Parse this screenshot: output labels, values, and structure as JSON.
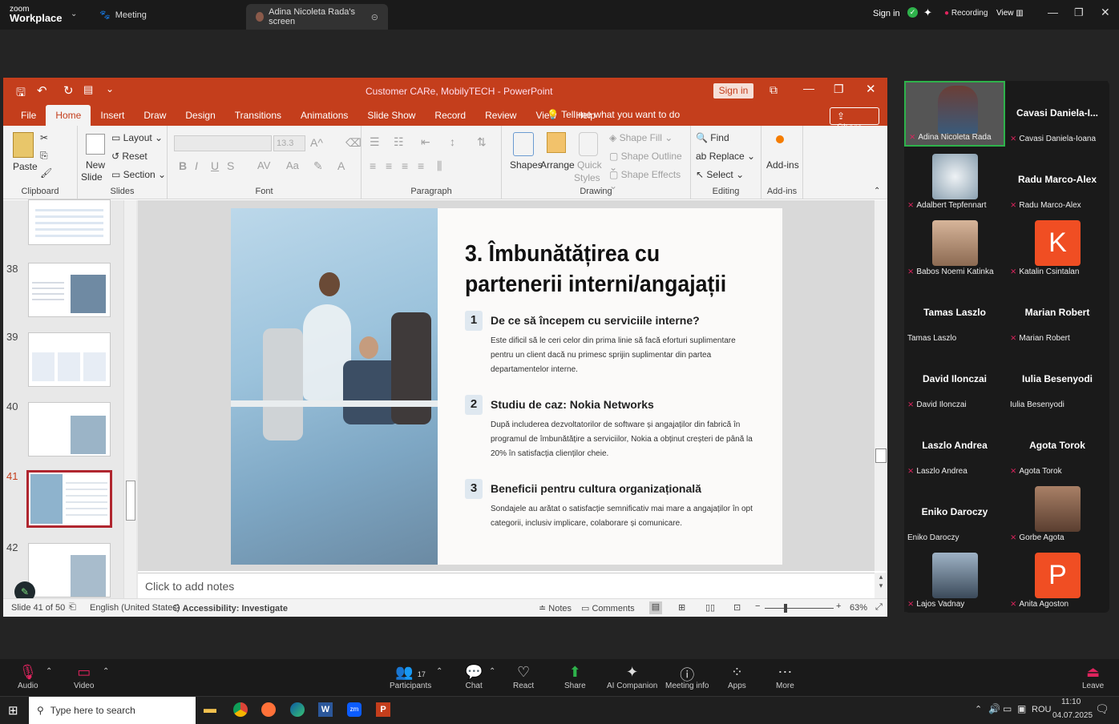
{
  "zoom": {
    "logo_top": "zoom",
    "logo_bottom": "Workplace",
    "meeting_tab": "Meeting",
    "share_tab": "Adina Nicoleta Rada's screen",
    "sign_in": "Sign in",
    "recording": "Recording",
    "view": "View"
  },
  "powerpoint": {
    "title": "Customer CARe, MobilyTECH  -  PowerPoint",
    "sign_in": "Sign in",
    "share": "Share",
    "tabs": [
      "File",
      "Home",
      "Insert",
      "Draw",
      "Design",
      "Transitions",
      "Animations",
      "Slide Show",
      "Record",
      "Review",
      "View",
      "Help"
    ],
    "tell_me": "Tell me what you want to do",
    "ribbon": {
      "paste": "Paste",
      "clipboard": "Clipboard",
      "new_slide_1": "New",
      "new_slide_2": "Slide",
      "layout": "Layout",
      "reset": "Reset",
      "section": "Section",
      "slides": "Slides",
      "font_size": "13.3",
      "font": "Font",
      "paragraph": "Paragraph",
      "shapes": "Shapes",
      "arrange": "Arrange",
      "quick_1": "Quick",
      "quick_2": "Styles",
      "shape_fill": "Shape Fill",
      "shape_outline": "Shape Outline",
      "shape_effects": "Shape Effects",
      "drawing": "Drawing",
      "find": "Find",
      "replace": "Replace",
      "select": "Select",
      "editing": "Editing",
      "addins": "Add-ins",
      "addins_group": "Add-ins"
    },
    "thumb_numbers": [
      "38",
      "39",
      "40",
      "41",
      "42"
    ],
    "slide": {
      "title": "3. Îmbunătățirea cu partenerii interni/angajații",
      "items": [
        {
          "num": "1",
          "heading": "De ce să începem cu serviciile interne?",
          "text": "Este dificil să le ceri celor din prima linie să facă eforturi suplimentare pentru un client dacă nu primesc sprijin suplimentar din partea departamentelor interne."
        },
        {
          "num": "2",
          "heading": "Studiu de caz: Nokia Networks",
          "text": "După includerea dezvoltatorilor de software și angajaților din fabrică în programul de îmbunătățire a serviciilor, Nokia a obținut creșteri de până la 20% în satisfacția clienților cheie."
        },
        {
          "num": "3",
          "heading": "Beneficii pentru cultura organizațională",
          "text": "Sondajele au arătat o satisfacție semnificativ mai mare a angajaților în opt categorii, inclusiv implicare, colaborare și comunicare."
        }
      ]
    },
    "notes_placeholder": "Click to add notes",
    "status": {
      "slide_of": "Slide 41 of 50",
      "language": "English (United States)",
      "accessibility": "Accessibility: Investigate",
      "notes": "Notes",
      "comments": "Comments",
      "zoom": "63%"
    }
  },
  "participants": [
    {
      "name": "Adina Nicoleta Rada",
      "big": ""
    },
    {
      "name": "Cavasi Daniela-Ioana",
      "big": "Cavasi  Daniela-I..."
    },
    {
      "name": "Adalbert Tepfennart",
      "big": ""
    },
    {
      "name": "Radu Marco-Alex",
      "big": "Radu Marco-Alex"
    },
    {
      "name": "Babos Noemi Katinka",
      "big": ""
    },
    {
      "name": "Katalin Csintalan",
      "big": ""
    },
    {
      "name": "Tamas Laszlo",
      "big": "Tamas Laszlo"
    },
    {
      "name": "Marian Robert",
      "big": "Marian Robert"
    },
    {
      "name": "David Ilonczai",
      "big": "David Ilonczai"
    },
    {
      "name": "Iulia Besenyodi",
      "big": "Iulia Besenyodi"
    },
    {
      "name": "Laszlo Andrea",
      "big": "Laszlo Andrea"
    },
    {
      "name": "Agota Torok",
      "big": "Agota Torok"
    },
    {
      "name": "Eniko Daroczy",
      "big": "Eniko Daroczy"
    },
    {
      "name": "Gorbe Agota",
      "big": ""
    },
    {
      "name": "Lajos Vadnay",
      "big": ""
    },
    {
      "name": "Anita Agoston",
      "big": ""
    }
  ],
  "avatar_letters": {
    "katalin": "K",
    "anita": "P"
  },
  "toolbar": {
    "audio": "Audio",
    "video": "Video",
    "participants": "Participants",
    "participants_count": "17",
    "chat": "Chat",
    "react": "React",
    "share": "Share",
    "ai": "AI Companion",
    "info": "Meeting info",
    "apps": "Apps",
    "more": "More",
    "leave": "Leave"
  },
  "taskbar": {
    "search": "Type here to search",
    "lang": "ROU",
    "time": "11:10",
    "date": "04.07.2025"
  }
}
